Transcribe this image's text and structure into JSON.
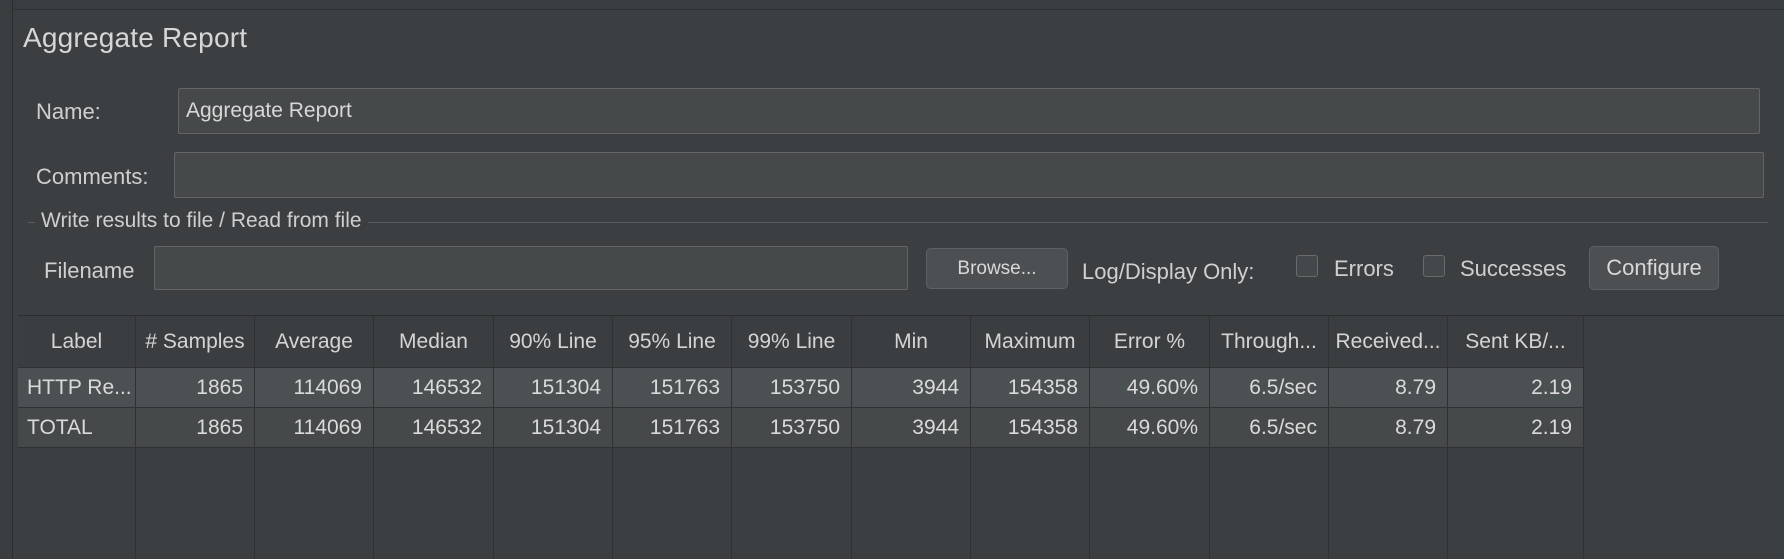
{
  "title": "Aggregate Report",
  "name_label": "Name:",
  "name_value": "Aggregate Report",
  "comments_label": "Comments:",
  "comments_value": "",
  "file_group_title": "Write results to file / Read from file",
  "filename_label": "Filename",
  "filename_value": "",
  "browse_label": "Browse...",
  "log_display_label": "Log/Display Only:",
  "errors_label": "Errors",
  "errors_checked": false,
  "successes_label": "Successes",
  "successes_checked": false,
  "configure_label": "Configure",
  "table": {
    "columns": [
      "Label",
      "# Samples",
      "Average",
      "Median",
      "90% Line",
      "95% Line",
      "99% Line",
      "Min",
      "Maximum",
      "Error %",
      "Through...",
      "Received...",
      "Sent KB/..."
    ],
    "rows": [
      [
        "HTTP Re...",
        "1865",
        "114069",
        "146532",
        "151304",
        "151763",
        "153750",
        "3944",
        "154358",
        "49.60%",
        "6.5/sec",
        "8.79",
        "2.19"
      ],
      [
        "TOTAL",
        "1865",
        "114069",
        "146532",
        "151304",
        "151763",
        "153750",
        "3944",
        "154358",
        "49.60%",
        "6.5/sec",
        "8.79",
        "2.19"
      ]
    ]
  }
}
